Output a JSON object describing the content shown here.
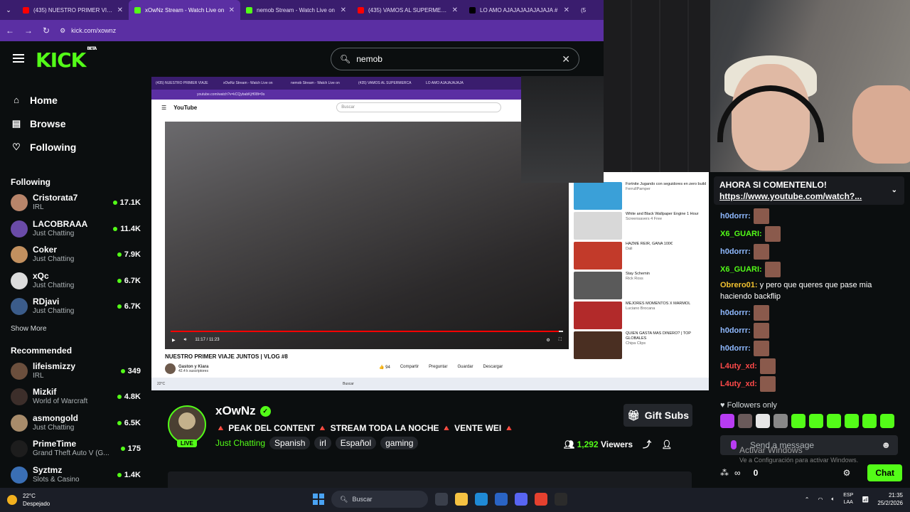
{
  "browser": {
    "tabs": [
      {
        "title": "(435) NUESTRO PRIMER VIAJE J",
        "favicon_color": "#ff0000",
        "active": false
      },
      {
        "title": "xOwNz Stream - Watch Live on",
        "favicon_color": "#53fc18",
        "active": true
      },
      {
        "title": "nemob Stream - Watch Live on",
        "favicon_color": "#53fc18",
        "active": false
      },
      {
        "title": "(435) VAMOS AL SUPERMERCA",
        "favicon_color": "#ff0000",
        "active": false
      },
      {
        "title": "LO AMO AJAJAJAJAJAJAJA #",
        "favicon_color": "#000000",
        "active": false
      }
    ],
    "extra_tab": "(5",
    "url": "kick.com/xownz"
  },
  "kick": {
    "logo": "KICK",
    "logo_badge": "BETA",
    "search": {
      "value": "nemob"
    },
    "nav": [
      {
        "label": "Home",
        "icon": "home-icon"
      },
      {
        "label": "Browse",
        "icon": "browse-icon"
      },
      {
        "label": "Following",
        "icon": "heart-icon"
      }
    ],
    "following_title": "Following",
    "following": [
      {
        "name": "Cristorata7",
        "category": "IRL",
        "viewers": "17.1K",
        "color": "#b8856a"
      },
      {
        "name": "LACOBRAAA",
        "category": "Just Chatting",
        "viewers": "11.4K",
        "color": "#6a4ba8"
      },
      {
        "name": "Coker",
        "category": "Just Chatting",
        "viewers": "7.9K",
        "color": "#c2905f"
      },
      {
        "name": "xQc",
        "category": "Just Chatting",
        "viewers": "6.7K",
        "color": "#dcdcdc"
      },
      {
        "name": "RDjavi",
        "category": "Just Chatting",
        "viewers": "6.7K",
        "color": "#3b5c8a"
      }
    ],
    "show_more": "Show More",
    "recommended_title": "Recommended",
    "recommended": [
      {
        "name": "lifeismizzy",
        "category": "IRL",
        "viewers": "349",
        "color": "#6b4f3d"
      },
      {
        "name": "Mizkif",
        "category": "World of Warcraft",
        "viewers": "4.8K",
        "color": "#3c2e2a"
      },
      {
        "name": "asmongold",
        "category": "Just Chatting",
        "viewers": "6.5K",
        "color": "#a88c6b"
      },
      {
        "name": "PrimeTime",
        "category": "Grand Theft Auto V (G...",
        "viewers": "175",
        "color": "#1d1d1d"
      },
      {
        "name": "Syztmz",
        "category": "Slots & Casino",
        "viewers": "1.4K",
        "color": "#3a6fb5"
      }
    ],
    "stream": {
      "name": "xOwNz",
      "live": "LIVE",
      "title": "🔺 PEAK DEL CONTENT 🔺 STREAM TODA LA NOCHE 🔺 VENTE WEI 🔺",
      "category": "Just Chatting",
      "tags": [
        "Spanish",
        "irl",
        "Español",
        "gaming"
      ],
      "gift": "Gift Subs",
      "viewers": "1,292",
      "viewers_label": "Viewers"
    }
  },
  "video": {
    "tabs": [
      "(435) NUESTRO PRIMER VIAJE",
      "xOwNz Stream - Watch Live on",
      "nemob Stream - Watch Live on",
      "(435) VAMOS AL SUPERMERCA",
      "LO AMO AJAJAJAJAJA"
    ],
    "url": "youtube.com/watch?v=kCQybabKjH08t=9s",
    "yt_logo": "YouTube",
    "yt_search": "Buscar",
    "time": "11:17 / 11:23",
    "progress": 0.99,
    "title": "NUESTRO PRIMER VIAJE JUNTOS | VLOG #8",
    "channel": "Gaston y Kiara",
    "subs": "42.4 k suscriptores",
    "actions": [
      "👍 94",
      "Compartir",
      "Preguntar",
      "Guardar",
      "Descargar"
    ],
    "recs": [
      {
        "title": "Fortnite Jugando con seguidores en zero build",
        "sub": "FerrullPamper",
        "color": "#3aa0d8"
      },
      {
        "title": "White and Black Wallpaper Engine 1 Hour",
        "sub": "Screensavers 4 Free",
        "color": "#d8d8d8"
      },
      {
        "title": "HAZME REIR, GANA 100€",
        "sub": "Dali",
        "color": "#c23a2a"
      },
      {
        "title": "Stay Schemin",
        "sub": "Rick Ross",
        "color": "#5a5a5a"
      },
      {
        "title": "MEJORES MOMENTOS X MARMOL",
        "sub": "Luciano Brocana",
        "color": "#b22a2a"
      },
      {
        "title": "QUIEN GASTA MAS DINERO? | TOP GLOBALES",
        "sub": "Chipa Clips",
        "color": "#4a2f22"
      }
    ],
    "taskbar_search": "Buscar",
    "taskbar_temp": "22°C"
  },
  "chat": {
    "pinned_text": "AHORA SI COMENTENLO!",
    "pinned_link": "https://www.youtube.com/watch?...",
    "messages": [
      {
        "user": "h0dorrr:",
        "color": "#8fb9ff",
        "text": ""
      },
      {
        "user": "X6_GUARI:",
        "color": "#53fc18",
        "text": ""
      },
      {
        "user": "h0dorrr:",
        "color": "#8fb9ff",
        "text": ""
      },
      {
        "user": "X6_GUARI:",
        "color": "#53fc18",
        "text": ""
      },
      {
        "user": "Obrero01:",
        "color": "#f2c230",
        "text": "y pero que queres que pase mia haciendo backflip"
      },
      {
        "user": "h0dorrr:",
        "color": "#8fb9ff",
        "text": ""
      },
      {
        "user": "h0dorrr:",
        "color": "#8fb9ff",
        "text": ""
      },
      {
        "user": "h0dorrr:",
        "color": "#8fb9ff",
        "text": ""
      },
      {
        "user": "L4uty_xd:",
        "color": "#ff4a4a",
        "text": ""
      },
      {
        "user": "L4uty_xd:",
        "color": "#ff4a4a",
        "text": ""
      }
    ],
    "followers_only": "Followers only",
    "send_placeholder": "Send a message",
    "count": "0",
    "chat_button": "Chat",
    "windows_watermark": "Activar Windows",
    "windows_watermark_sub": "Ve a Configuración para activar Windows."
  },
  "taskbar": {
    "temp": "22°C",
    "weather": "Despejado",
    "search": "Buscar",
    "lang1": "ESP",
    "lang2": "LAA",
    "time": "21:35",
    "date": "25/2/2026"
  },
  "colors": {
    "kick_green": "#53fc18",
    "browser_purple": "#5b2fa3",
    "bg": "#0b0e0f"
  }
}
